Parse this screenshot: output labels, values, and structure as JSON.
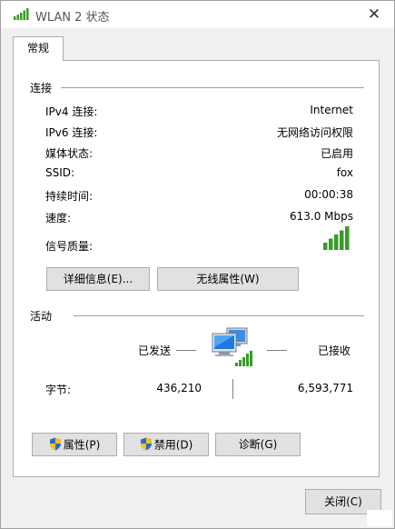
{
  "window": {
    "title": "WLAN 2 状态",
    "close_glyph": "✕"
  },
  "tabs": [
    {
      "label": "常规"
    }
  ],
  "connection": {
    "label": "连接",
    "rows": [
      {
        "label": "IPv4 连接:",
        "value": "Internet"
      },
      {
        "label": "IPv6 连接:",
        "value": "无网络访问权限"
      },
      {
        "label": "媒体状态:",
        "value": "已启用"
      },
      {
        "label": "SSID:",
        "value": "fox"
      },
      {
        "label": "持续时间:",
        "value": "00:00:38"
      },
      {
        "label": "速度:",
        "value": "613.0 Mbps"
      }
    ],
    "signal_label": "信号质量:",
    "signal_bars": 5,
    "signal_bars_max": 5,
    "details_button": "详细信息(E)...",
    "wireless_button": "无线属性(W)"
  },
  "activity": {
    "label": "活动",
    "sent_label": "已发送",
    "received_label": "已接收",
    "bytes_label": "字节:",
    "bytes_sent": "436,210",
    "bytes_received": "6,593,771"
  },
  "buttons": {
    "properties": "属性(P)",
    "disable": "禁用(D)",
    "diagnose": "诊断(G)",
    "close": "关闭(C)"
  },
  "icons": {
    "title": "wifi-signal-icon",
    "signal": "signal-strength-icon",
    "network": "network-computers-icon",
    "shield": "uac-shield-icon"
  },
  "colors": {
    "signal_green": "#3a9a2a",
    "panel_border": "#adadad",
    "button_bg": "#e1e1e1"
  }
}
